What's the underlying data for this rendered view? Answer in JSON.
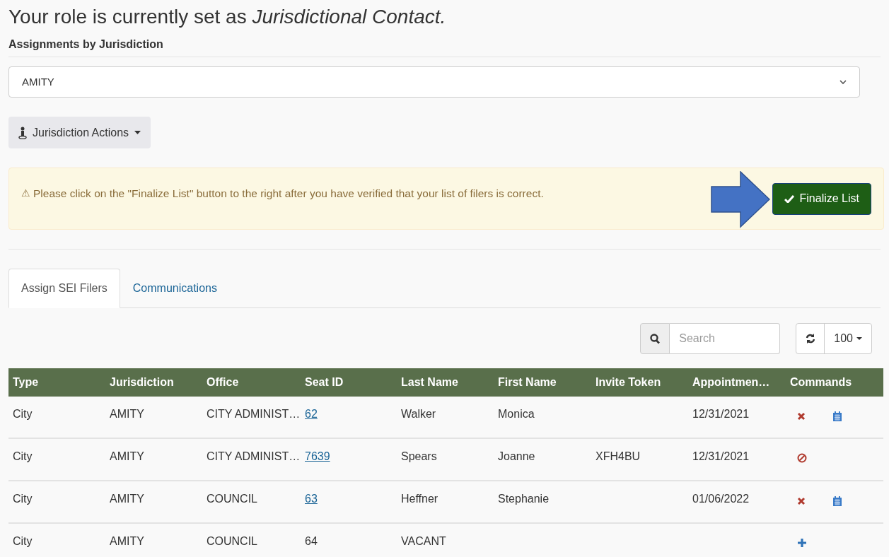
{
  "heading": "Your role is currently set as *Jurisdictional Contact.*",
  "section_label": "Assignments by Jurisdiction",
  "jurisdiction_select": {
    "value": "AMITY"
  },
  "actions_button": {
    "label": "Jurisdiction Actions"
  },
  "alert": {
    "icon": "⚠",
    "message": "Please click on the \"Finalize List\" button to the right after you have verified that your list of filers is correct.",
    "button": "Finalize List"
  },
  "tabs": [
    {
      "label": "Assign SEI Filers",
      "selected": true
    },
    {
      "label": "Communications",
      "selected": false
    }
  ],
  "search": {
    "placeholder": "Search"
  },
  "page_size": "100",
  "table": {
    "columns": [
      "Type",
      "Jurisdiction",
      "Office",
      "Seat ID",
      "Last Name",
      "First Name",
      "Invite Token",
      "Appointmen…",
      "Commands"
    ],
    "rows": [
      {
        "cells": [
          "City",
          "AMITY",
          "CITY ADMINIST…",
          "62",
          "Walker",
          "Monica",
          "",
          "12/31/2021"
        ],
        "seat_linked": true,
        "commands": [
          {
            "kind": "remove"
          },
          {
            "kind": "calendar"
          }
        ]
      },
      {
        "cells": [
          "City",
          "AMITY",
          "CITY ADMINIST…",
          "7639",
          "Spears",
          "Joanne",
          "XFH4BU",
          "12/31/2021"
        ],
        "seat_linked": true,
        "commands": [
          {
            "kind": "block"
          }
        ]
      },
      {
        "cells": [
          "City",
          "AMITY",
          "COUNCIL",
          "63",
          "Heffner",
          "Stephanie",
          "",
          "01/06/2022"
        ],
        "seat_linked": true,
        "commands": [
          {
            "kind": "remove"
          },
          {
            "kind": "calendar"
          }
        ]
      },
      {
        "cells": [
          "City",
          "AMITY",
          "COUNCIL",
          "64",
          "VACANT",
          "",
          "",
          ""
        ],
        "seat_linked": false,
        "commands": [
          {
            "kind": "add"
          }
        ]
      }
    ]
  }
}
